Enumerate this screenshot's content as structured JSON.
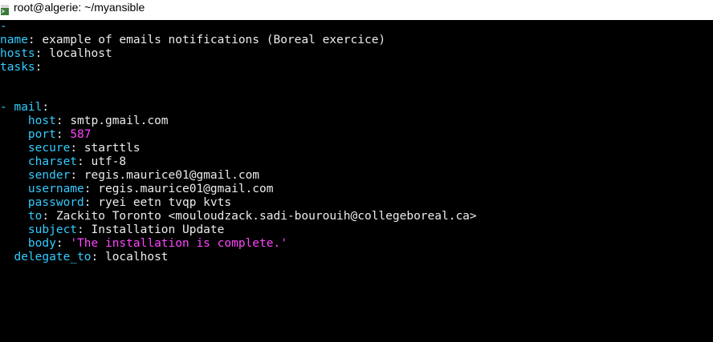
{
  "window": {
    "title": "root@algerie: ~/myansible"
  },
  "colors": {
    "key": "#33ccff",
    "string": "#ff44ff",
    "text": "#ececec",
    "background": "#000000"
  },
  "terminal": {
    "doc_start": "-",
    "play": {
      "name_key": "name",
      "name_value": "example of emails notifications (Boreal exercice)",
      "hosts_key": "hosts",
      "hosts_value": "localhost",
      "tasks_key": "tasks"
    },
    "task": {
      "module": "mail",
      "fields": [
        {
          "key": "host",
          "value": "smtp.gmail.com"
        },
        {
          "key": "port",
          "value": "587"
        },
        {
          "key": "secure",
          "value": "starttls"
        },
        {
          "key": "charset",
          "value": "utf-8"
        },
        {
          "key": "sender",
          "value": "regis.maurice01@gmail.com"
        },
        {
          "key": "username",
          "value": "regis.maurice01@gmail.com"
        },
        {
          "key": "password",
          "value": "ryei eetn tvqp kvts"
        },
        {
          "key": "to",
          "value": "Zackito Toronto <mouloudzack.sadi-bourouih@collegeboreal.ca>"
        },
        {
          "key": "subject",
          "value": "Installation Update"
        },
        {
          "key": "body",
          "value": "'The installation is complete.'"
        }
      ],
      "delegate_key": "delegate_to",
      "delegate_value": "localhost"
    }
  }
}
